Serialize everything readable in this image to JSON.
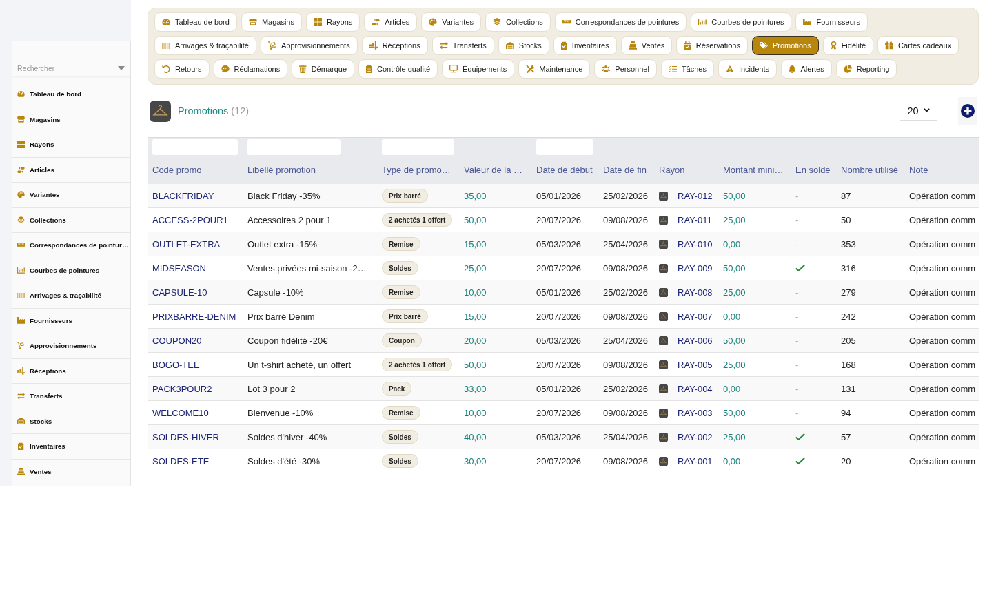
{
  "sidebar": {
    "search": {
      "placeholder": "Rechercher"
    },
    "items": [
      {
        "label": "Tableau de bord",
        "selected": false
      },
      {
        "label": "Magasins",
        "selected": false
      },
      {
        "label": "Rayons",
        "selected": false
      },
      {
        "label": "Articles",
        "selected": false
      },
      {
        "label": "Variantes",
        "selected": false
      },
      {
        "label": "Collections",
        "selected": false
      },
      {
        "label": "Correspondances de pointur…",
        "selected": false
      },
      {
        "label": "Courbes de pointures",
        "selected": false
      },
      {
        "label": "Arrivages & traçabilité",
        "selected": false
      },
      {
        "label": "Fournisseurs",
        "selected": false
      },
      {
        "label": "Approvisionnements",
        "selected": false
      },
      {
        "label": "Réceptions",
        "selected": false
      },
      {
        "label": "Transferts",
        "selected": false
      },
      {
        "label": "Stocks",
        "selected": false
      },
      {
        "label": "Inventaires",
        "selected": false
      },
      {
        "label": "Ventes",
        "selected": false
      }
    ]
  },
  "nav": {
    "items": [
      {
        "label": "Tableau de bord",
        "selected": false
      },
      {
        "label": "Magasins",
        "selected": false
      },
      {
        "label": "Rayons",
        "selected": false
      },
      {
        "label": "Articles",
        "selected": false
      },
      {
        "label": "Variantes",
        "selected": false
      },
      {
        "label": "Collections",
        "selected": false
      },
      {
        "label": "Correspondances de pointures",
        "selected": false
      },
      {
        "label": "Courbes de pointures",
        "selected": false
      },
      {
        "label": "Fournisseurs",
        "selected": false
      },
      {
        "label": "Arrivages & traçabilité",
        "selected": false
      },
      {
        "label": "Approvisionnements",
        "selected": false
      },
      {
        "label": "Réceptions",
        "selected": false
      },
      {
        "label": "Transferts",
        "selected": false
      },
      {
        "label": "Stocks",
        "selected": false
      },
      {
        "label": "Inventaires",
        "selected": false
      },
      {
        "label": "Ventes",
        "selected": false
      },
      {
        "label": "Réservations",
        "selected": false
      },
      {
        "label": "Promotions",
        "selected": true
      },
      {
        "label": "Fidélité",
        "selected": false
      },
      {
        "label": "Cartes cadeaux",
        "selected": false
      },
      {
        "label": "Retours",
        "selected": false
      },
      {
        "label": "Réclamations",
        "selected": false
      },
      {
        "label": "Démarque",
        "selected": false
      },
      {
        "label": "Contrôle qualité",
        "selected": false
      },
      {
        "label": "Équipements",
        "selected": false
      },
      {
        "label": "Maintenance",
        "selected": false
      },
      {
        "label": "Personnel",
        "selected": false
      },
      {
        "label": "Tâches",
        "selected": false
      },
      {
        "label": "Incidents",
        "selected": false
      },
      {
        "label": "Alertes",
        "selected": false
      },
      {
        "label": "Reporting",
        "selected": false
      }
    ]
  },
  "header": {
    "title": "Promotions",
    "count": "(12)",
    "page_size": "20"
  },
  "table": {
    "columns": [
      {
        "label": "Code promo",
        "filter": true
      },
      {
        "label": "Libellé promotion",
        "filter": true
      },
      {
        "label": "Type de promo…",
        "filter": true
      },
      {
        "label": "Valeur de la …",
        "filter": false
      },
      {
        "label": "Date de début",
        "filter": true
      },
      {
        "label": "Date de fin",
        "filter": false
      },
      {
        "label": "Rayon",
        "filter": false
      },
      {
        "label": "Montant mini…",
        "filter": false
      },
      {
        "label": "En solde",
        "filter": false
      },
      {
        "label": "Nombre utilisé",
        "filter": false
      },
      {
        "label": "Note",
        "filter": false
      }
    ],
    "rows": [
      {
        "code": "BLACKFRIDAY",
        "label": "Black Friday -35%",
        "type": "Prix barré",
        "value": "35,00",
        "start": "05/01/2026",
        "end": "25/02/2026",
        "rayon": "RAY-012",
        "min_amount": "50,00",
        "on_sale": false,
        "on_sale_text": "-",
        "uses": "87",
        "note": "Opération comm"
      },
      {
        "code": "ACCESS-2POUR1",
        "label": "Accessoires 2 pour 1",
        "type": "2 achetés 1 offert",
        "value": "50,00",
        "start": "20/07/2026",
        "end": "09/08/2026",
        "rayon": "RAY-011",
        "min_amount": "25,00",
        "on_sale": false,
        "on_sale_text": "-",
        "uses": "50",
        "note": "Opération comm"
      },
      {
        "code": "OUTLET-EXTRA",
        "label": "Outlet extra -15%",
        "type": "Remise",
        "value": "15,00",
        "start": "05/03/2026",
        "end": "25/04/2026",
        "rayon": "RAY-010",
        "min_amount": "0,00",
        "on_sale": false,
        "on_sale_text": "-",
        "uses": "353",
        "note": "Opération comm"
      },
      {
        "code": "MIDSEASON",
        "label": "Ventes privées mi-saison -2…",
        "type": "Soldes",
        "value": "25,00",
        "start": "20/07/2026",
        "end": "09/08/2026",
        "rayon": "RAY-009",
        "min_amount": "50,00",
        "on_sale": true,
        "uses": "316",
        "note": "Opération comm"
      },
      {
        "code": "CAPSULE-10",
        "label": "Capsule -10%",
        "type": "Remise",
        "value": "10,00",
        "start": "05/01/2026",
        "end": "25/02/2026",
        "rayon": "RAY-008",
        "min_amount": "25,00",
        "on_sale": false,
        "on_sale_text": "-",
        "uses": "279",
        "note": "Opération comm"
      },
      {
        "code": "PRIXBARRE-DENIM",
        "label": "Prix barré Denim",
        "type": "Prix barré",
        "value": "15,00",
        "start": "20/07/2026",
        "end": "09/08/2026",
        "rayon": "RAY-007",
        "min_amount": "0,00",
        "on_sale": false,
        "on_sale_text": "-",
        "uses": "242",
        "note": "Opération comm"
      },
      {
        "code": "COUPON20",
        "label": "Coupon fidélité -20€",
        "type": "Coupon",
        "value": "20,00",
        "start": "05/03/2026",
        "end": "25/04/2026",
        "rayon": "RAY-006",
        "min_amount": "50,00",
        "on_sale": false,
        "on_sale_text": "-",
        "uses": "205",
        "note": "Opération comm"
      },
      {
        "code": "BOGO-TEE",
        "label": "Un t-shirt acheté, un offert",
        "type": "2 achetés 1 offert",
        "value": "50,00",
        "start": "20/07/2026",
        "end": "09/08/2026",
        "rayon": "RAY-005",
        "min_amount": "25,00",
        "on_sale": false,
        "on_sale_text": "-",
        "uses": "168",
        "note": "Opération comm"
      },
      {
        "code": "PACK3POUR2",
        "label": "Lot 3 pour 2",
        "type": "Pack",
        "value": "33,00",
        "start": "05/01/2026",
        "end": "25/02/2026",
        "rayon": "RAY-004",
        "min_amount": "0,00",
        "on_sale": false,
        "on_sale_text": "-",
        "uses": "131",
        "note": "Opération comm"
      },
      {
        "code": "WELCOME10",
        "label": "Bienvenue -10%",
        "type": "Remise",
        "value": "10,00",
        "start": "20/07/2026",
        "end": "09/08/2026",
        "rayon": "RAY-003",
        "min_amount": "50,00",
        "on_sale": false,
        "on_sale_text": "-",
        "uses": "94",
        "note": "Opération comm"
      },
      {
        "code": "SOLDES-HIVER",
        "label": "Soldes d'hiver -40%",
        "type": "Soldes",
        "value": "40,00",
        "start": "05/03/2026",
        "end": "25/04/2026",
        "rayon": "RAY-002",
        "min_amount": "25,00",
        "on_sale": true,
        "uses": "57",
        "note": "Opération comm"
      },
      {
        "code": "SOLDES-ETE",
        "label": "Soldes d'été -30%",
        "type": "Soldes",
        "value": "30,00",
        "start": "20/07/2026",
        "end": "09/08/2026",
        "rayon": "RAY-001",
        "min_amount": "0,00",
        "on_sale": true,
        "uses": "20",
        "note": "Opération comm"
      }
    ]
  }
}
